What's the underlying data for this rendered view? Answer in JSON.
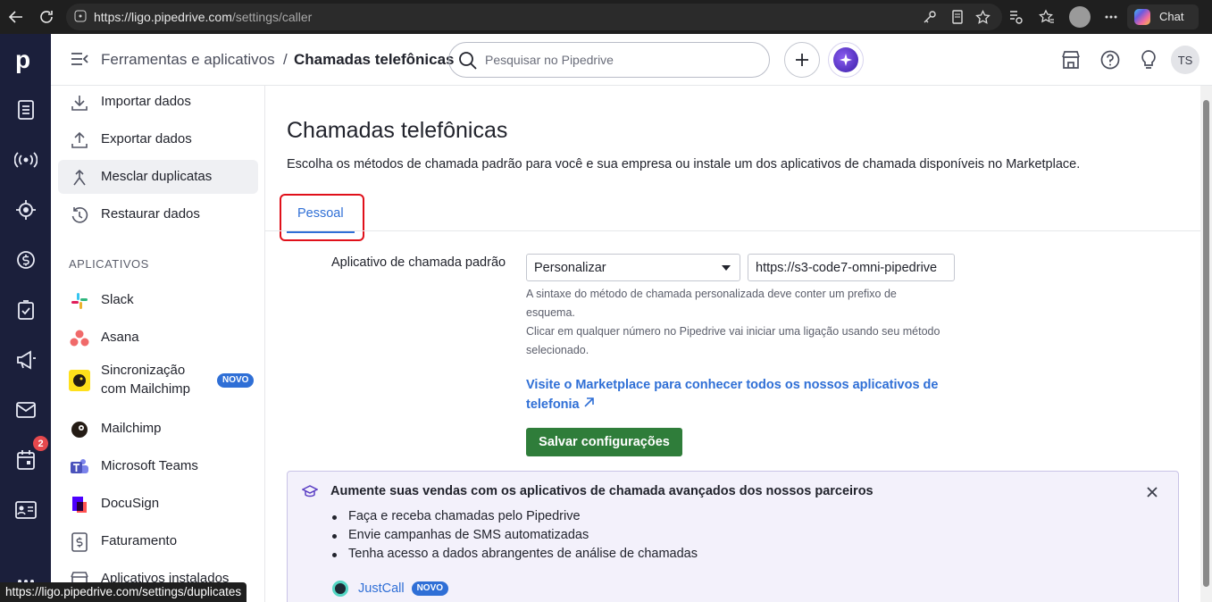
{
  "browser": {
    "url_host": "https://ligo.pipedrive.com",
    "url_path": "/settings/caller",
    "chat_label": "Chat",
    "status_url": "https://ligo.pipedrive.com/settings/duplicates"
  },
  "header": {
    "breadcrumb_parent": "Ferramentas e aplicativos",
    "breadcrumb_sep": "/",
    "breadcrumb_current": "Chamadas telefônicas",
    "search_placeholder": "Pesquisar no Pipedrive",
    "avatar_initials": "TS"
  },
  "rail": {
    "logo": "p",
    "calendar_badge": "2",
    "icons": [
      "leads-icon",
      "broadcast-icon",
      "target-icon",
      "deals-icon",
      "activities-icon",
      "campaigns-icon",
      "mail-icon",
      "calendar-icon",
      "contacts-icon",
      "more-icon"
    ]
  },
  "sidebar": {
    "items": [
      {
        "label": "Importar dados",
        "icon": "download-icon"
      },
      {
        "label": "Exportar dados",
        "icon": "upload-icon"
      },
      {
        "label": "Mesclar duplicatas",
        "icon": "merge-icon"
      },
      {
        "label": "Restaurar dados",
        "icon": "restore-icon"
      }
    ],
    "section_title": "APLICATIVOS",
    "apps": [
      {
        "label": "Slack",
        "icon": "slack-icon"
      },
      {
        "label": "Asana",
        "icon": "asana-icon"
      },
      {
        "label_line1": "Sincronização",
        "label_line2": "com Mailchimp",
        "icon": "mailchimp-icon",
        "badge": "NOVO"
      },
      {
        "label": "Mailchimp",
        "icon": "mailchimp-bw-icon"
      },
      {
        "label": "Microsoft Teams",
        "icon": "teams-icon"
      },
      {
        "label": "DocuSign",
        "icon": "docusign-icon"
      },
      {
        "label": "Faturamento",
        "icon": "billing-icon"
      },
      {
        "label": "Aplicativos instalados",
        "icon": "installed-apps-icon"
      }
    ]
  },
  "main": {
    "title": "Chamadas telefônicas",
    "description": "Escolha os métodos de chamada padrão para você e sua empresa ou instale um dos aplicativos de chamada disponíveis no Marketplace.",
    "tab_label": "Pessoal",
    "field_label": "Aplicativo de chamada padrão",
    "select_value": "Personalizar",
    "url_value": "https://s3-code7-omni-pipedrive",
    "hint_1": "A sintaxe do método de chamada personalizada deve conter um prefixo de",
    "hint_2": "esquema.",
    "hint_3": "Clicar em qualquer número no Pipedrive vai iniciar uma ligação usando seu método",
    "hint_4": "selecionado.",
    "marketplace_link": "Visite o Marketplace para conhecer todos os nossos aplicativos de telefonia",
    "save_button": "Salvar configurações"
  },
  "promo": {
    "title": "Aumente suas vendas com os aplicativos de chamada avançados dos nossos parceiros",
    "bullets": [
      "Faça e receba chamadas pelo Pipedrive",
      "Envie campanhas de SMS automatizadas",
      "Tenha acesso a dados abrangentes de análise de chamadas"
    ],
    "partner_name": "JustCall",
    "partner_badge": "NOVO"
  },
  "colors": {
    "rail_bg": "#1b1f3b",
    "accent_blue": "#2f6fd6",
    "save_green": "#2f7d3a",
    "highlight_red": "#e0101a"
  }
}
